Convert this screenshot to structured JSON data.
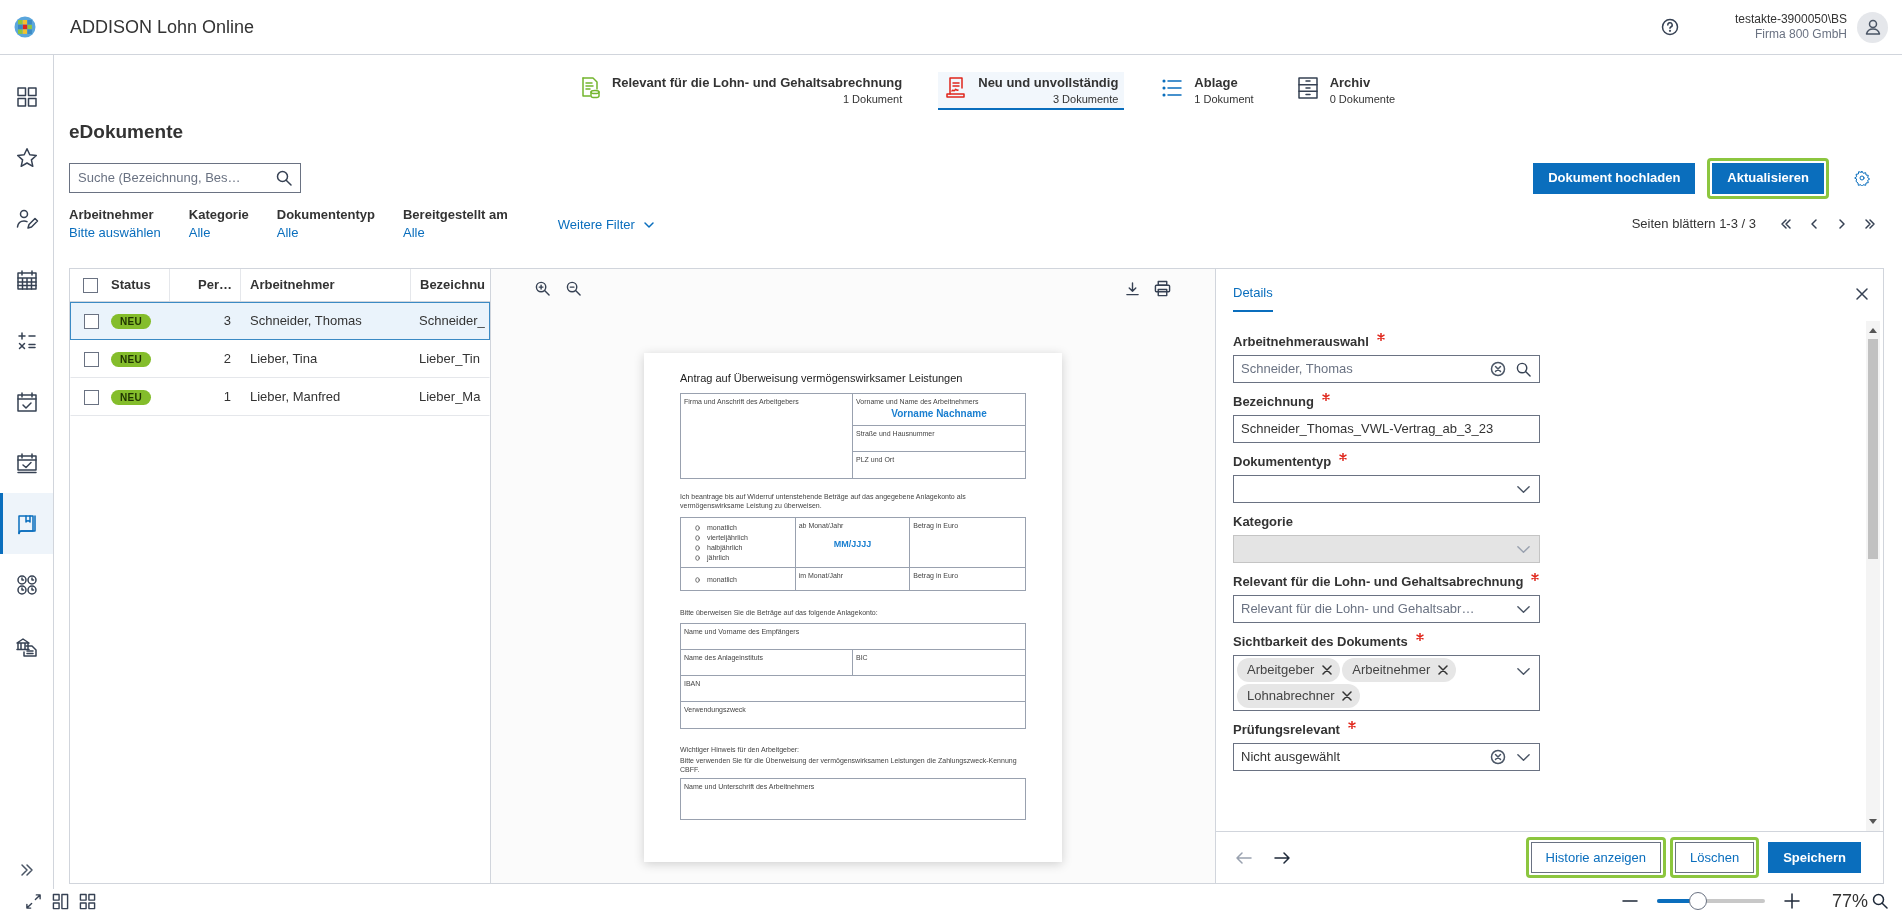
{
  "app": {
    "title": "ADDISON Lohn Online"
  },
  "header": {
    "user": "testakte-3900050\\BS",
    "company": "Firma 800 GmbH"
  },
  "sidebar": {
    "items": [
      {
        "selected": false
      },
      {
        "selected": false
      },
      {
        "selected": false
      },
      {
        "selected": false
      },
      {
        "selected": false
      },
      {
        "selected": false
      },
      {
        "selected": false
      },
      {
        "selected": true
      },
      {
        "selected": false
      },
      {
        "selected": false
      }
    ]
  },
  "doc_tabs": [
    {
      "label": "Relevant für die Lohn- und Gehaltsabrechnung",
      "count": "1 Dokument",
      "selected": false
    },
    {
      "label": "Neu und unvollständig",
      "count": "3 Dokumente",
      "selected": true
    },
    {
      "label": "Ablage",
      "count": "1 Dokument",
      "selected": false
    },
    {
      "label": "Archiv",
      "count": "0 Dokumente",
      "selected": false
    }
  ],
  "page_title": "eDokumente",
  "search": {
    "placeholder": "Suche (Bezeichnung, Bes…"
  },
  "buttons": [
    {
      "label": "Dokument hochladen",
      "highlighted": false
    },
    {
      "label": "Aktualisieren",
      "highlighted": true
    }
  ],
  "filters": [
    {
      "label": "Arbeitnehmer",
      "value": "Bitte auswählen"
    },
    {
      "label": "Kategorie",
      "value": "Alle"
    },
    {
      "label": "Dokumententyp",
      "value": "Alle"
    },
    {
      "label": "Bereitgestellt am",
      "value": "Alle"
    }
  ],
  "more_filters": "Weitere Filter",
  "pager": "Seiten blättern 1-3 / 3",
  "table": {
    "all_checked": false,
    "columns": [
      "Status",
      "Per…",
      "Arbeitnehmer",
      "Bezeichnu"
    ],
    "rows": [
      {
        "checked": false,
        "selected": true,
        "status": "NEU",
        "period": "3",
        "employee": "Schneider, Thomas",
        "title": "Schneider_"
      },
      {
        "checked": false,
        "selected": false,
        "status": "NEU",
        "period": "2",
        "employee": "Lieber, Tina",
        "title": "Lieber_Tin"
      },
      {
        "checked": false,
        "selected": false,
        "status": "NEU",
        "period": "1",
        "employee": "Lieber, Manfred",
        "title": "Lieber_Ma"
      }
    ]
  },
  "document": {
    "title": "Antrag auf Überweisung vermögenswirksamer Leistungen",
    "employer_label": "Firma und Anschrift des Arbeitgebers",
    "employee_label": "Vorname und Name des Arbeitnehmers",
    "employee_name": "Vorname Nachname",
    "street_label": "Straße und Hausnummer",
    "city_label": "PLZ und Ort",
    "intro": "Ich beantrage bis auf Widerruf untenstehende Beträge auf das angegebene Anlagekonto als vermögenswirksame Leistung zu überweisen.",
    "intervals": [
      "monatlich",
      "vierteljährlich",
      "halbjährlich",
      "jährlich"
    ],
    "from_label": "ab Monat/Jahr",
    "date_placeholder": "MM/JJJJ",
    "amount_label": "Betrag in Euro",
    "single_interval": "monatlich",
    "in_label": "im Monat/Jahr",
    "single_amount_label": "Betrag in Euro",
    "account_intro": "Bitte überweisen Sie die Beträge auf das folgende Anlagekonto:",
    "recipient_label": "Name und Vorname des Empfängers",
    "institute_label": "Name des Anlageinstituts",
    "bic_label": "BIC",
    "iban_label": "IBAN",
    "purpose_label": "Verwendungszweck",
    "notice_title": "Wichtiger Hinweis für den Arbeitgeber:",
    "notice_text": "Bitte verwenden Sie für die Überweisung der vermögenswirksamen Leistungen die Zahlungszweck-Kennung CBFF.",
    "signature_label": "Name und Unterschrift des Arbeitnehmers"
  },
  "details": {
    "tab": "Details",
    "fields": [
      {
        "kind": "search",
        "label": "Arbeitnehmerauswahl",
        "required": true,
        "value": "Schneider, Thomas",
        "clearable": true
      },
      {
        "kind": "text",
        "label": "Bezeichnung",
        "required": true,
        "value": "Schneider_Thomas_VWL-Vertrag_ab_3_23"
      },
      {
        "kind": "select",
        "label": "Dokumententyp",
        "required": true,
        "disabled": false
      },
      {
        "kind": "select",
        "label": "Kategorie",
        "required": false,
        "disabled": true
      },
      {
        "kind": "select",
        "label": "Relevant für die Lohn- und Gehaltsabrechnung",
        "required": true,
        "disabled": false,
        "placeholder": "Relevant für die Lohn- und Gehaltsabr…"
      },
      {
        "kind": "tags",
        "label": "Sichtbarkeit des Dokuments",
        "required": true,
        "tags": [
          "Arbeitgeber",
          "Arbeitnehmer",
          "Lohnabrechner"
        ]
      },
      {
        "kind": "select",
        "label": "Prüfungsrelevant",
        "required": true,
        "disabled": false,
        "value": "Nicht ausgewählt",
        "clearable": true
      }
    ],
    "previous": {
      "disabled": true
    },
    "next": {
      "disabled": false
    },
    "buttons": [
      {
        "label": "Historie anzeigen",
        "kind": "secondary",
        "highlighted": true
      },
      {
        "label": "Löschen",
        "kind": "secondary",
        "highlighted": true
      },
      {
        "label": "Speichern",
        "kind": "primary",
        "highlighted": false
      }
    ]
  },
  "status_bar": {
    "zoom": {
      "level": 0.38,
      "reading": "77%"
    }
  }
}
